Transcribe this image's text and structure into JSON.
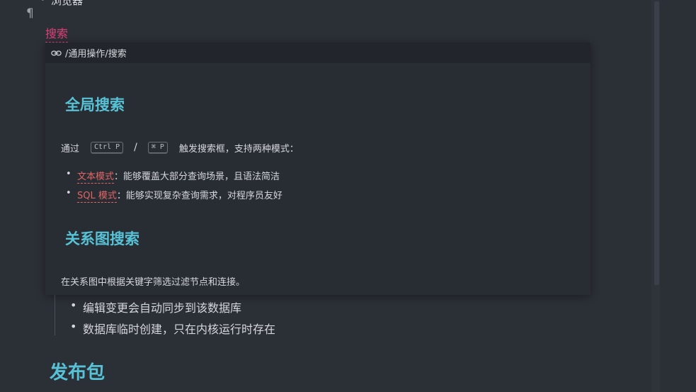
{
  "editor": {
    "pilcrow": "¶",
    "top_bullet": "浏览器",
    "search_link": "搜索",
    "blockquote_items": [
      "编辑变更会自动同步到该数据库",
      "数据库临时创建，只在内核运行时存在"
    ],
    "heading_publish": "发布包"
  },
  "popover": {
    "path": "/通用操作/搜索",
    "icon": "link-icon",
    "heading_global": "全局搜索",
    "trigger": {
      "prefix": "通过",
      "kbd_win": "Ctrl P",
      "slash": "/",
      "kbd_mac": "⌘ P",
      "suffix": "触发搜索框，支持两种模式："
    },
    "modes": [
      {
        "name": "文本模式",
        "desc": "：能够覆盖大部分查询场景，且语法简洁"
      },
      {
        "name": "SQL 模式",
        "desc": "：能够实现复杂查询需求，对程序员友好"
      }
    ],
    "heading_graph": "关系图搜索",
    "graph_desc": "在关系图中根据关键字筛选过滤节点和连接。"
  },
  "colors": {
    "background": "#2b2f36",
    "heading": "#57c2d6",
    "link_pink": "#e0407a",
    "link_red": "#e06666",
    "text": "#d5d8dd"
  }
}
